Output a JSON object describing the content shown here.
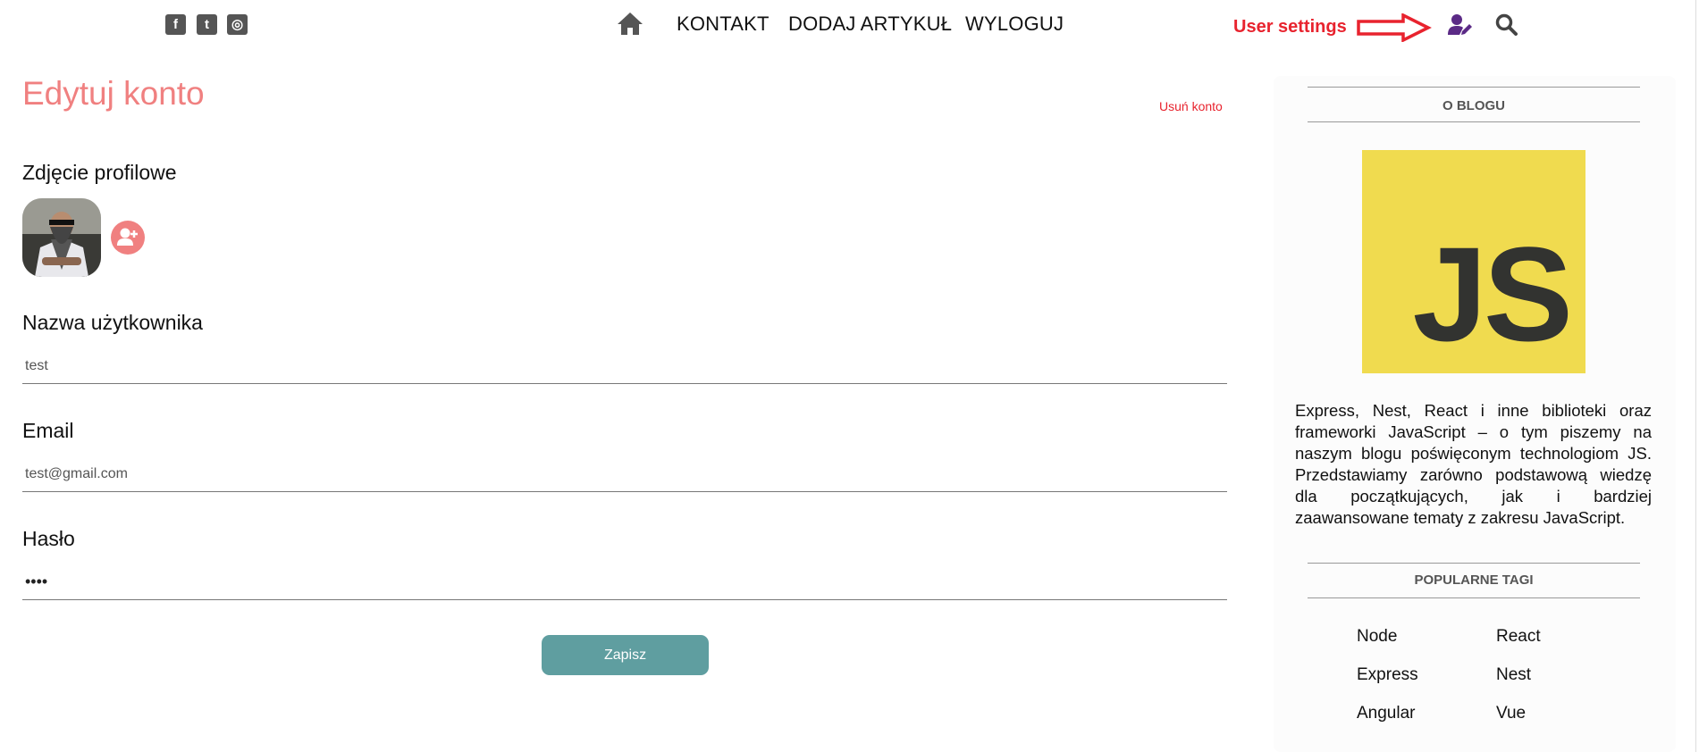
{
  "header": {
    "social": [
      {
        "icon": "facebook-icon",
        "glyph": "f"
      },
      {
        "icon": "twitter-icon",
        "glyph": "t"
      },
      {
        "icon": "instagram-icon",
        "glyph": "◎"
      }
    ],
    "nav": {
      "home_icon": "home-icon",
      "items": [
        "KONTAKT",
        "DODAJ ARTYKUŁ",
        "WYLOGUJ"
      ]
    },
    "annotation": {
      "label": "User settings",
      "color": "#e8232e"
    },
    "user_settings_icon": "user-edit-icon",
    "search_icon": "search-icon"
  },
  "main": {
    "title": "Edytuj konto",
    "delete_account": "Usuń konto",
    "profile_photo_label": "Zdjęcie profilowe",
    "add_photo_icon": "user-plus-icon",
    "username": {
      "label": "Nazwa użytkownika",
      "value": "test"
    },
    "email": {
      "label": "Email",
      "value": "test@gmail.com"
    },
    "password": {
      "label": "Hasło",
      "value": "••••"
    },
    "save_label": "Zapisz"
  },
  "sidebar": {
    "about_heading": "O BLOGU",
    "logo_text": "JS",
    "description": "Express, Nest, React i inne biblioteki oraz frameworki JavaScript – o tym piszemy na naszym blogu poświęconym technologiom JS. Przedstawiamy zarówno podstawową wiedzę dla początkujących, jak i bardziej zaawansowane tematy z zakresu JavaScript.",
    "tags_heading": "POPULARNE TAGI",
    "tags": [
      "Node",
      "React",
      "Express",
      "Nest",
      "Angular",
      "Vue"
    ]
  },
  "colors": {
    "accent": "#f08080",
    "button": "#5f9ea0",
    "js_yellow": "#f0db4f",
    "user_icon": "#5b2a86"
  }
}
